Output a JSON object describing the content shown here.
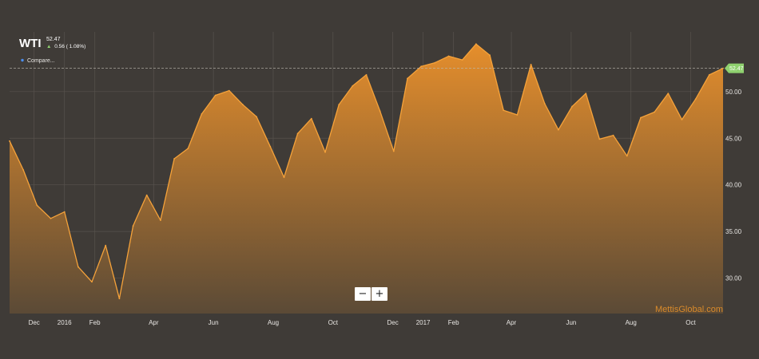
{
  "header": {
    "symbol": "WTI",
    "price": "52.47",
    "change": "0.56 ( 1.08%)",
    "compare_label": "Compare..."
  },
  "price_tag": "52.47",
  "watermark": "MettisGlobal.com",
  "zoom": {
    "minus": "−",
    "plus": "+"
  },
  "colors": {
    "background": "#3f3b37",
    "line": "#f5a23a",
    "fill_top": "#e58e2c",
    "fill_bottom": "#5b4a36",
    "price_tag": "#8fd16f"
  },
  "chart_data": {
    "type": "area",
    "title": "WTI",
    "xlabel": "",
    "ylabel": "",
    "ylim": [
      26.2,
      56.4
    ],
    "y_ticks": [
      30,
      35,
      40,
      45,
      50
    ],
    "y_tick_labels": [
      "30.00",
      "35.00",
      "40.00",
      "45.00",
      "50.00"
    ],
    "x_tick_labels": [
      "Dec",
      "2016",
      "Feb",
      "Apr",
      "Jun",
      "Aug",
      "Oct",
      "Dec",
      "2017",
      "Feb",
      "Apr",
      "Jun",
      "Aug",
      "Oct"
    ],
    "x_tick_dates": [
      "2015-12-01",
      "2016-01-01",
      "2016-02-01",
      "2016-04-01",
      "2016-06-01",
      "2016-08-01",
      "2016-10-01",
      "2016-12-01",
      "2017-01-01",
      "2017-02-01",
      "2017-04-01",
      "2017-06-01",
      "2017-08-01",
      "2017-10-01"
    ],
    "grid": true,
    "series": [
      {
        "name": "WTI",
        "x": [
          "2015-11-06",
          "2015-11-20",
          "2015-12-04",
          "2015-12-18",
          "2016-01-01",
          "2016-01-15",
          "2016-01-29",
          "2016-02-12",
          "2016-02-26",
          "2016-03-11",
          "2016-03-25",
          "2016-04-08",
          "2016-04-22",
          "2016-05-06",
          "2016-05-20",
          "2016-06-03",
          "2016-06-17",
          "2016-07-01",
          "2016-07-15",
          "2016-07-29",
          "2016-08-12",
          "2016-08-26",
          "2016-09-09",
          "2016-09-23",
          "2016-10-07",
          "2016-10-21",
          "2016-11-04",
          "2016-11-18",
          "2016-12-02",
          "2016-12-16",
          "2016-12-30",
          "2017-01-13",
          "2017-01-27",
          "2017-02-10",
          "2017-02-24",
          "2017-03-10",
          "2017-03-24",
          "2017-04-07",
          "2017-04-21",
          "2017-05-05",
          "2017-05-19",
          "2017-06-02",
          "2017-06-16",
          "2017-06-30",
          "2017-07-14",
          "2017-07-28",
          "2017-08-11",
          "2017-08-25",
          "2017-09-08",
          "2017-09-22",
          "2017-10-06",
          "2017-10-20",
          "2017-11-03"
        ],
        "values": [
          44.7,
          41.6,
          37.8,
          36.4,
          37.1,
          31.2,
          29.6,
          33.5,
          27.8,
          35.6,
          38.9,
          36.2,
          42.8,
          43.9,
          47.6,
          49.6,
          50.1,
          48.6,
          47.3,
          44.1,
          40.8,
          45.5,
          47.1,
          43.5,
          48.6,
          50.6,
          51.8,
          47.9,
          43.6,
          51.4,
          52.7,
          53.1,
          53.8,
          53.4,
          55.1,
          53.9,
          48.0,
          47.5,
          52.9,
          48.7,
          45.9,
          48.4,
          49.8,
          44.9,
          45.3,
          43.1,
          47.2,
          47.8,
          49.8,
          47.0,
          49.2,
          51.8,
          52.5
        ]
      }
    ]
  }
}
